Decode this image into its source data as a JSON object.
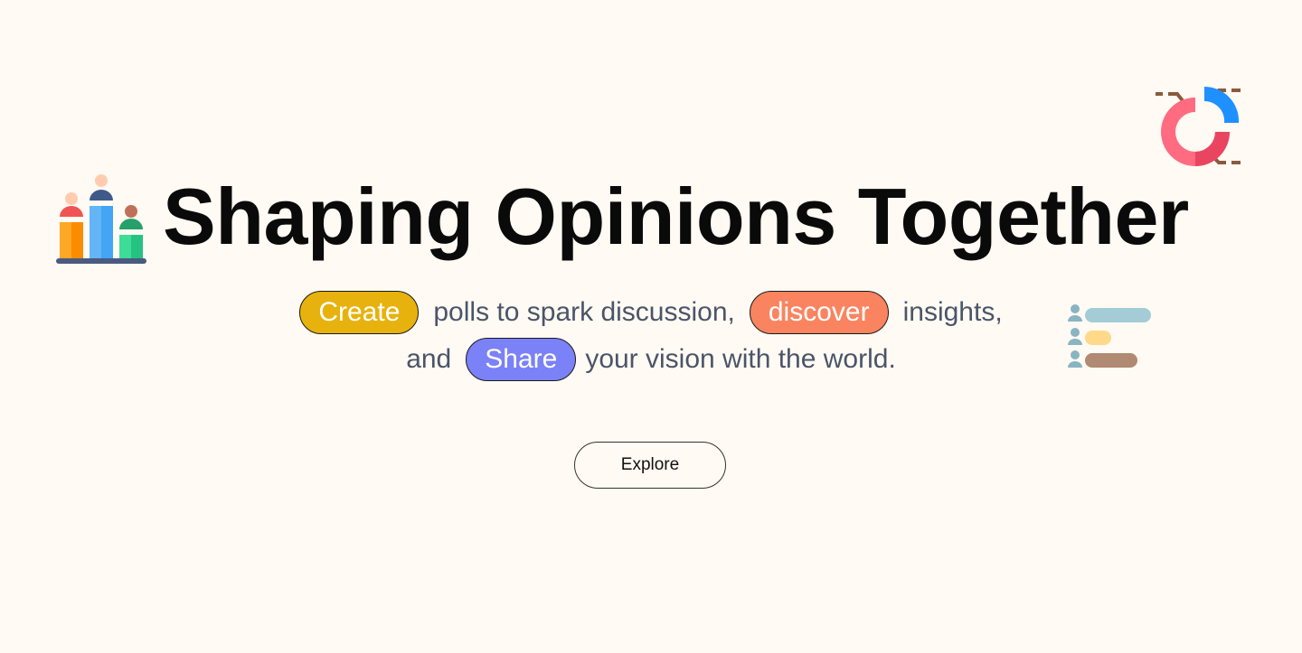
{
  "hero": {
    "title": "Shaping Opinions Together",
    "line1": {
      "pill_create": "Create",
      "text_a": "polls to spark discussion,",
      "pill_discover": "discover",
      "text_b": "insights,"
    },
    "line2": {
      "text_a": "and",
      "pill_share": "Share",
      "text_b": "your vision with the world."
    },
    "explore_label": "Explore"
  },
  "icons": {
    "podium": "people-podium-icon",
    "donut": "donut-chart-icon",
    "people_list": "people-list-icon"
  },
  "colors": {
    "background": "#fffaf3",
    "create_pill": "#e7b20d",
    "discover_pill": "#fa8460",
    "share_pill": "#7b81f6",
    "body_text": "#4a5568"
  }
}
